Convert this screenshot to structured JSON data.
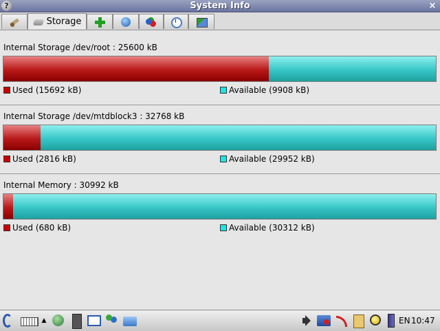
{
  "window": {
    "title": "System Info",
    "help_icon": "?",
    "close_icon": "×"
  },
  "tabs": [
    {
      "icon": "wrench-icon",
      "label": ""
    },
    {
      "icon": "disk-icon",
      "label": "Storage",
      "active": true
    },
    {
      "icon": "plus-icon",
      "label": ""
    },
    {
      "icon": "network-icon",
      "label": ""
    },
    {
      "icon": "apps-icon",
      "label": ""
    },
    {
      "icon": "clock-icon",
      "label": ""
    },
    {
      "icon": "map-icon",
      "label": ""
    }
  ],
  "storage": [
    {
      "heading": "Internal Storage /dev/root : 25600 kB",
      "used_fraction": 0.613,
      "used_label": "Used (15692 kB)",
      "available_label": "Available (9908 kB)"
    },
    {
      "heading": "Internal Storage /dev/mtdblock3 : 32768 kB",
      "used_fraction": 0.086,
      "used_label": "Used (2816 kB)",
      "available_label": "Available (29952 kB)"
    },
    {
      "heading": "Internal Memory : 30992 kB",
      "used_fraction": 0.022,
      "used_label": "Used (680 kB)",
      "available_label": "Available (30312 kB)"
    }
  ],
  "colors": {
    "used": "#cc0000",
    "available": "#19e6e6"
  },
  "taskbar": {
    "language": "EN",
    "time": "10:47"
  }
}
